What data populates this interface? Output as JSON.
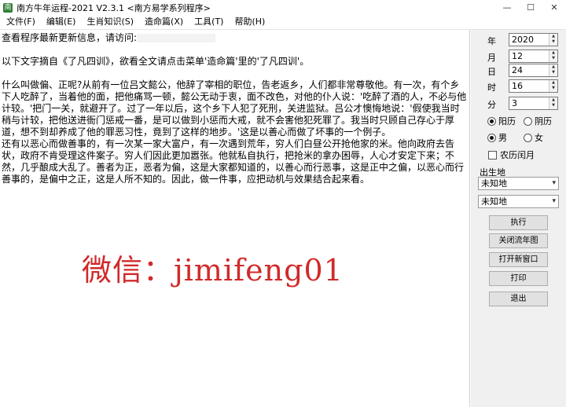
{
  "window": {
    "title": "南方牛年运程-2021  V2.3.1  <南方易学系列程序>",
    "minimize_label": "—",
    "maximize_label": "☐",
    "close_label": "✕"
  },
  "menu": {
    "items": [
      "文件(F)",
      "编辑(E)",
      "生肖知识(S)",
      "造命篇(X)",
      "工具(T)",
      "帮助(H)"
    ]
  },
  "content": {
    "line_update": "查看程序最新更新信息，请访问:",
    "line_source": "以下文字摘自《了凡四训》，欲看全文请点击菜单'造命篇'里的'了凡四训'。",
    "para1": "什么叫做偏、正呢?从前有一位吕文懿公，他辞了宰相的职位，告老返乡，人们都非常尊敬他。有一次，有个乡下人吃醉了，当着他的面，把他痛骂一顿，懿公无动于衷，面不改色，对他的仆人说：'吃醉了酒的人，不必与他计较。'把门一关，就避开了。过了一年以后，这个乡下人犯了死刑，关进监狱。吕公才懊悔地说：'假使我当时稍与计较，把他送进衙门惩戒一番，是可以做到小惩而大戒，就不会害他犯死罪了。我当时只顾自己存心于厚道，想不到却养成了他的罪恶习性，竟到了这样的地步。'这是以善心而做了坏事的一个例子。",
    "para2": "还有以恶心而做善事的，有一次某一家大富户，有一次遇到荒年，穷人们白昼公开抢他家的米。他向政府去告状，政府不肯受理这件案子。穷人们因此更加嚣张。他就私自执行，把抢米的拿办困辱，人心才安定下来；不然，几乎酿成大乱了。善者为正，恶者为偏，这是大家都知道的，以善心而行恶事，这是正中之偏，以恶心而行善事的，是偏中之正，这是人所不知的。因此，做一件事，应把动机与效果结合起来看。",
    "watermark": "微信：jimifeng01"
  },
  "form": {
    "fields": [
      {
        "label": "年",
        "value": "2020"
      },
      {
        "label": "月",
        "value": "12"
      },
      {
        "label": "日",
        "value": "24"
      },
      {
        "label": "时",
        "value": "16"
      },
      {
        "label": "分",
        "value": "3"
      }
    ],
    "calendar": {
      "solar": "阳历",
      "lunar": "阴历",
      "selected": "solar"
    },
    "gender": {
      "male": "男",
      "female": "女",
      "selected": "male"
    },
    "leap_month_label": "农历闰月",
    "leap_month_checked": false,
    "birthplace_label": "出生地",
    "birthplace_value1": "未知地",
    "birthplace_value2": "未知地",
    "buttons": {
      "run": "执行",
      "close_flow": "关闭流年图",
      "new_window": "打开新窗口",
      "print": "打印",
      "exit": "退出"
    }
  }
}
